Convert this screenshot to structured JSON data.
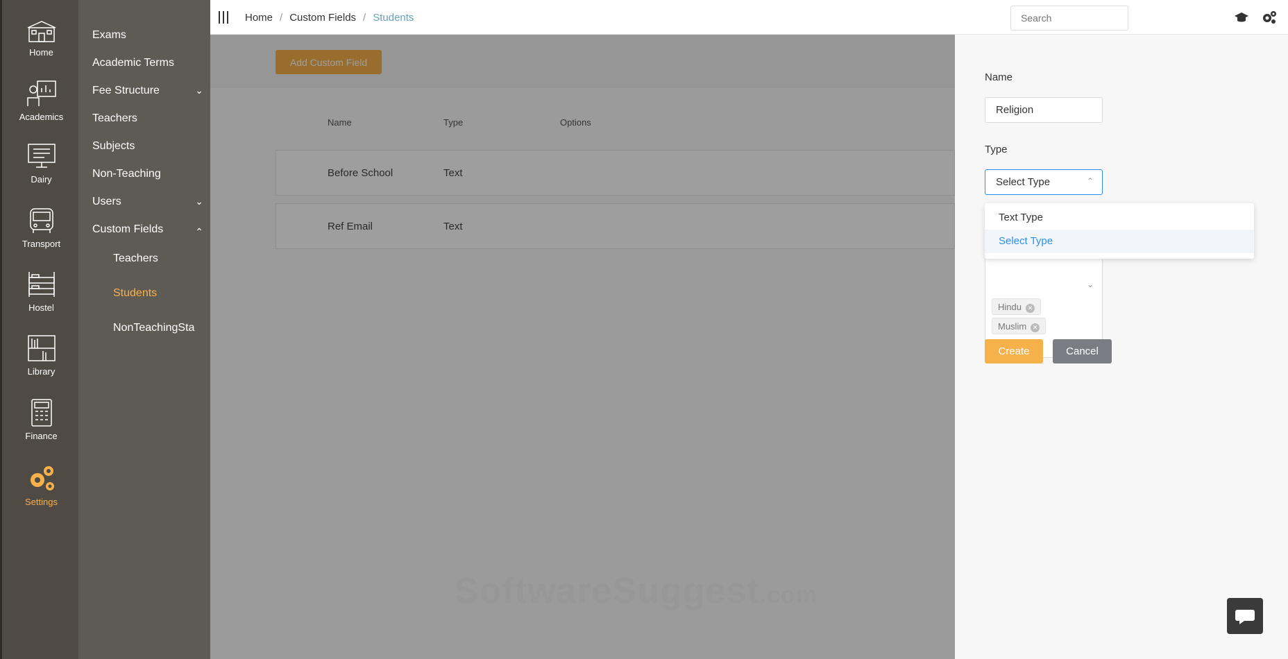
{
  "rail": [
    {
      "label": "Home",
      "icon": "school-building-icon"
    },
    {
      "label": "Academics",
      "icon": "teacher-board-icon"
    },
    {
      "label": "Dairy",
      "icon": "computer-diary-icon"
    },
    {
      "label": "Transport",
      "icon": "bus-icon"
    },
    {
      "label": "Hostel",
      "icon": "bunk-bed-icon"
    },
    {
      "label": "Library",
      "icon": "bookshelf-icon"
    },
    {
      "label": "Finance",
      "icon": "calculator-icon"
    },
    {
      "label": "Settings",
      "icon": "gears-icon",
      "active": true
    }
  ],
  "menu": {
    "items": [
      "Exams",
      "Academic Terms",
      "Fee Structure",
      "Teachers",
      "Subjects",
      "Non-Teaching",
      "Users",
      "Custom Fields"
    ],
    "subitems": [
      "Teachers",
      "Students",
      "NonTeachingSta"
    ]
  },
  "breadcrumb": {
    "home": "Home",
    "section": "Custom Fields",
    "current": "Students"
  },
  "search": {
    "placeholder": "Search"
  },
  "content": {
    "add_button": "Add Custom Field",
    "columns": [
      "Name",
      "Type",
      "Options"
    ],
    "rows": [
      {
        "name": "Before School",
        "type": "Text"
      },
      {
        "name": "Ref Email",
        "type": "Text"
      }
    ]
  },
  "watermark": {
    "main": "SoftwareSuggest",
    "suffix": ".com"
  },
  "form": {
    "name_label": "Name",
    "name_value": "Religion",
    "type_label": "Type",
    "type_value": "Select Type",
    "dropdown_options": [
      "Text Type",
      "Select Type"
    ],
    "tags": [
      "Hindu",
      "Muslim"
    ],
    "create_label": "Create",
    "cancel_label": "Cancel"
  },
  "colors": {
    "accent": "#f7b14a",
    "link": "#2b8ff0",
    "rail": "#4f4a43",
    "menu": "#5e5a54"
  }
}
